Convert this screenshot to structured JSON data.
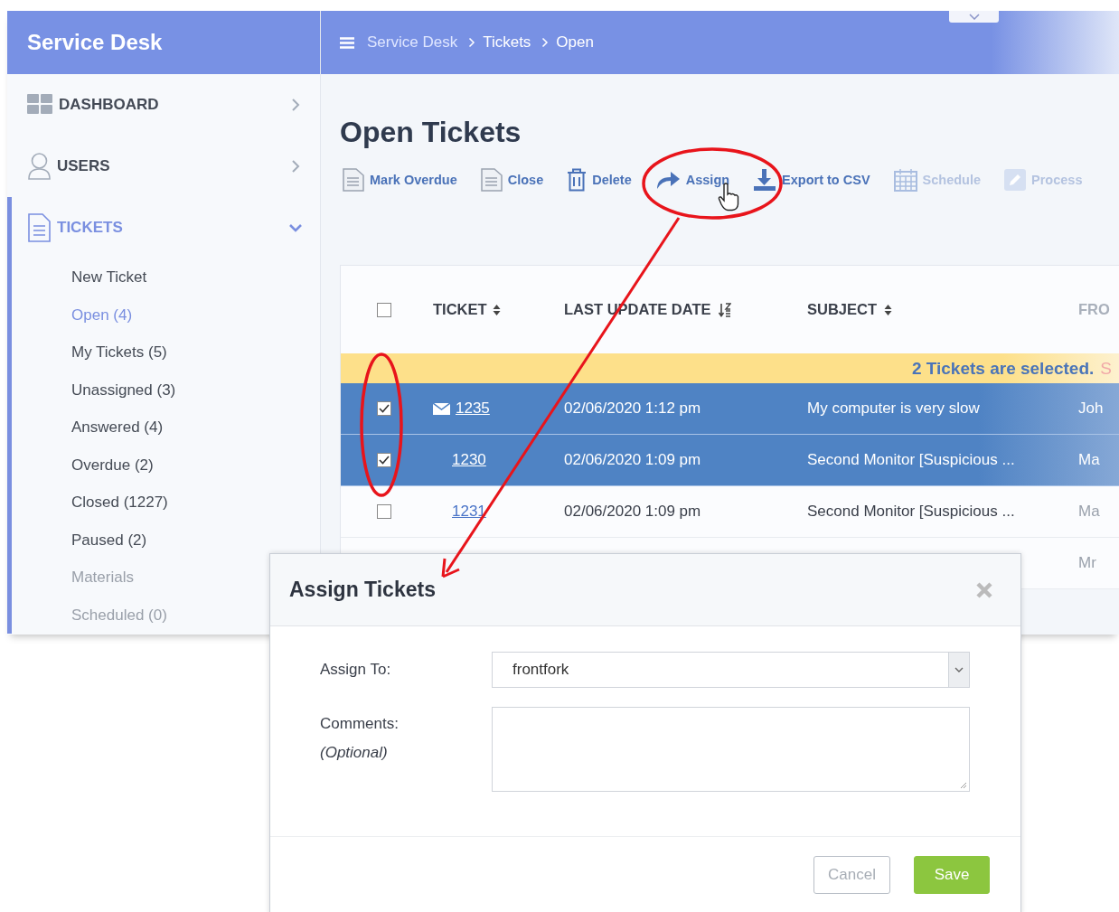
{
  "sidebar": {
    "title": "Service Desk",
    "items": [
      {
        "label": "DASHBOARD",
        "kind": "grid",
        "expanded": false,
        "selected": false
      },
      {
        "label": "USERS",
        "kind": "person",
        "expanded": false,
        "selected": false
      },
      {
        "label": "TICKETS",
        "kind": "document",
        "expanded": true,
        "selected": true,
        "children": [
          {
            "label": "New Ticket",
            "selected": false,
            "disabled": false
          },
          {
            "label": "Open (4)",
            "selected": true,
            "disabled": false
          },
          {
            "label": "My Tickets (5)",
            "selected": false,
            "disabled": false
          },
          {
            "label": "Unassigned (3)",
            "selected": false,
            "disabled": false
          },
          {
            "label": "Answered (4)",
            "selected": false,
            "disabled": false
          },
          {
            "label": "Overdue (2)",
            "selected": false,
            "disabled": false
          },
          {
            "label": "Closed (1227)",
            "selected": false,
            "disabled": false
          },
          {
            "label": "Paused (2)",
            "selected": false,
            "disabled": false
          },
          {
            "label": "Materials",
            "selected": false,
            "disabled": true
          },
          {
            "label": "Scheduled (0)",
            "selected": false,
            "disabled": true
          }
        ]
      }
    ]
  },
  "breadcrumb": [
    "Service Desk",
    "Tickets",
    "Open"
  ],
  "page_title": "Open Tickets",
  "toolbar": [
    {
      "label": "Mark Overdue",
      "kind": "document",
      "disabled": false
    },
    {
      "label": "Close",
      "kind": "document",
      "disabled": false
    },
    {
      "label": "Delete",
      "kind": "trash",
      "disabled": false
    },
    {
      "label": "Assign",
      "kind": "share",
      "disabled": false
    },
    {
      "label": "Export to CSV",
      "kind": "download",
      "disabled": false
    },
    {
      "label": "Schedule",
      "kind": "calendar",
      "disabled": true
    },
    {
      "label": "Process",
      "kind": "pencil",
      "disabled": true
    }
  ],
  "table": {
    "header_checked": false,
    "columns": [
      {
        "label": "TICKET",
        "sorted": false
      },
      {
        "label": "LAST UPDATE DATE",
        "sorted": true
      },
      {
        "label": "SUBJECT",
        "sorted": false
      },
      {
        "label": "FRO"
      }
    ],
    "selection_banner": {
      "text": "2 Tickets are selected.",
      "link": "S"
    },
    "rows": [
      {
        "checked": true,
        "selected": true,
        "email": true,
        "ticket": "1235",
        "date": "02/06/2020 1:12 pm",
        "subject": "My computer is very slow",
        "column_4": "Joh"
      },
      {
        "checked": true,
        "selected": true,
        "email": false,
        "ticket": "1230",
        "date": "02/06/2020 1:09 pm",
        "subject": "Second Monitor [Suspicious ...",
        "column_4": "Ma"
      },
      {
        "checked": false,
        "selected": false,
        "email": false,
        "ticket": "1231",
        "date": "02/06/2020 1:09 pm",
        "subject": "Second Monitor [Suspicious ...",
        "column_4": "Ma"
      },
      {
        "column_4": "Mr"
      }
    ]
  },
  "modal": {
    "title": "Assign Tickets",
    "fields": [
      {
        "label": "Assign To:",
        "kind": "select",
        "value": "frontfork"
      },
      {
        "label": "Comments:",
        "hint": "(Optional)",
        "kind": "textarea"
      }
    ],
    "buttons": [
      {
        "label": "Cancel",
        "kind": "secondary"
      },
      {
        "label": "Save",
        "kind": "primary"
      }
    ]
  }
}
